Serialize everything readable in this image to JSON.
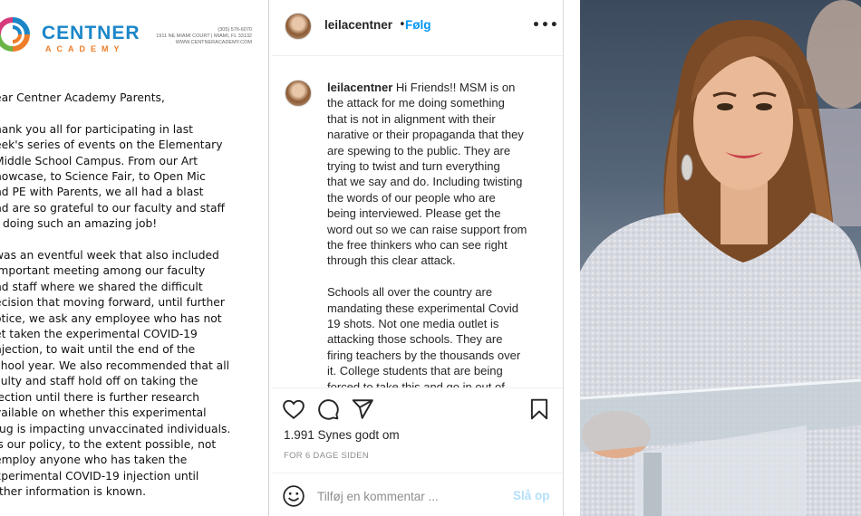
{
  "letter": {
    "brand_name": "CENTNER",
    "brand_sub": "ACADEMY",
    "address_lines": [
      "(305) 576-6070",
      "1911 NE MIAMI COURT | MIAMI, FL 33132",
      "WWW.CENTNERACADEMY.COM"
    ],
    "body_lines": [
      "ear Centner Academy Parents,",
      "",
      "hank you all for participating in last",
      "eek's series of events on the Elementary",
      "Middle School Campus. From our Art",
      "howcase, to Science Fair, to Open Mic",
      "nd PE with Parents, we all had a blast",
      "nd are so grateful to our faculty and staff",
      "r doing such an amazing job!",
      "",
      "was an eventful week that also included",
      "important meeting among our faculty",
      "nd staff where we shared the difficult",
      "ecision that moving forward, until further",
      "otice, we ask any employee who has not",
      "et taken the experimental COVID-19",
      "njection, to wait until the end of the",
      "chool year. We also recommended that all",
      "culty and staff hold off on taking the",
      "jection until there is further research",
      "vailable on whether this experimental",
      "rug is impacting unvaccinated individuals.",
      "is our policy, to the extent possible, not",
      "employ anyone who has taken the",
      "xperimental COVID-19 injection until",
      "rther information is known."
    ]
  },
  "instagram": {
    "username": "leilacentner",
    "separator": "•",
    "follow_label": "Følg",
    "more_label": "•••",
    "caption_lines": [
      "Hi Friends!! MSM is on",
      "the attack for me doing something",
      "that is not in alignment with their",
      "narative or their propaganda that they",
      "are spewing to the public. They are",
      "trying to twist and turn everything",
      "that we say and do. Including twisting",
      "the words of our people who are",
      "being interviewed. Please get the",
      "word out so we can raise support from",
      "the free thinkers who can see right",
      "through this clear attack.",
      "",
      "Schools all over the country are",
      "mandating these experimental Covid",
      "19 shots. Not one media outlet is",
      "attacking those schools. They are",
      "firing teachers by the thousands over",
      "it. College students that are being",
      "forced to take this and go in out of"
    ],
    "likes_text": "1.991 Synes godt om",
    "timestamp": "FOR 6 DAGE SIDEN",
    "comment_placeholder": "Tilføj en kommentar ...",
    "post_label": "Slå op",
    "colors": {
      "link": "#0095f6",
      "post_disabled": "#b2dffc",
      "muted": "#8e8e8e"
    }
  }
}
